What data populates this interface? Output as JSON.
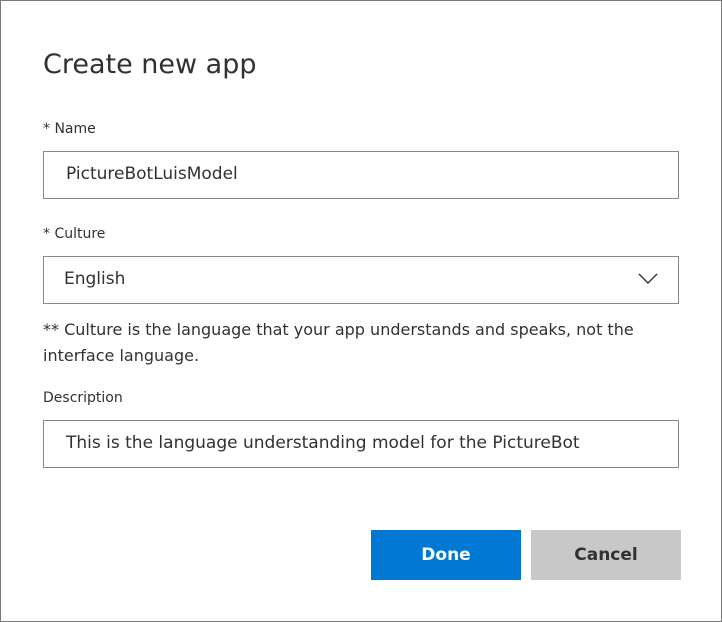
{
  "dialog": {
    "title": "Create new app",
    "name": {
      "label": "* Name",
      "value": "PictureBotLuisModel"
    },
    "culture": {
      "label": "* Culture",
      "selected": "English",
      "icon": "chevron-down-icon",
      "note": "** Culture is the language that your app understands and speaks, not the interface language."
    },
    "description": {
      "label": "Description",
      "value": "This is the language understanding model for the PictureBot"
    },
    "buttons": {
      "done": "Done",
      "cancel": "Cancel"
    }
  },
  "colors": {
    "primary": "#0078d4",
    "secondary": "#c8c8c8",
    "text": "#323130",
    "border": "#8a8886"
  }
}
